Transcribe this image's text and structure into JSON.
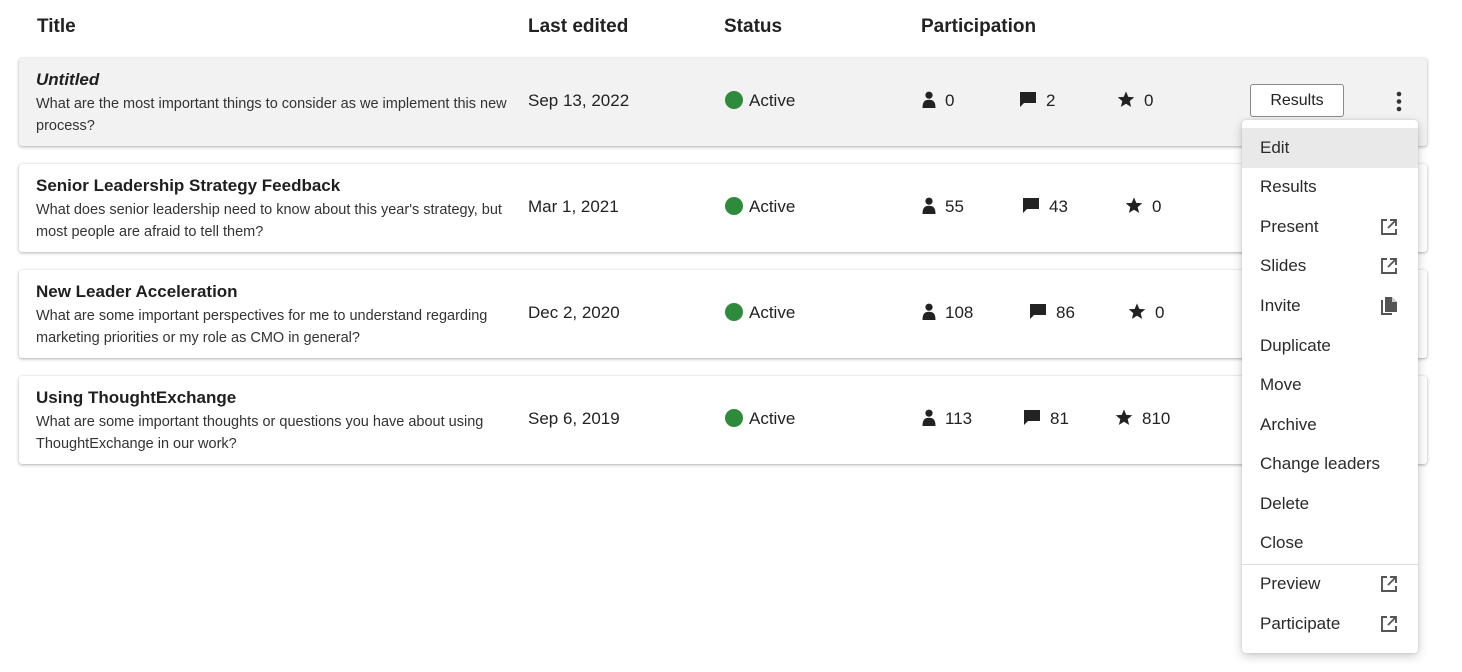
{
  "columns": {
    "title": "Title",
    "last_edited": "Last edited",
    "status": "Status",
    "participation": "Participation"
  },
  "exchanges": [
    {
      "title": "Untitled",
      "description": "What are the most important things to consider as we implement this new process?",
      "last_edited": "Sep 13, 2022",
      "status": "Active",
      "participants": "0",
      "thoughts": "2",
      "stars": "0"
    },
    {
      "title": "Senior Leadership Strategy Feedback",
      "description": "What does senior leadership need to know about this year's strategy, but most people are afraid to tell them?",
      "last_edited": "Mar 1, 2021",
      "status": "Active",
      "participants": "55",
      "thoughts": "43",
      "stars": "0"
    },
    {
      "title": "New Leader Acceleration",
      "description": "What are some important perspectives for me to understand regarding marketing priorities or my role as CMO in general?",
      "last_edited": "Dec 2, 2020",
      "status": "Active",
      "participants": "108",
      "thoughts": "86",
      "stars": "0"
    },
    {
      "title": "Using ThoughtExchange",
      "description": "What are some important thoughts or questions you have about using ThoughtExchange in our work?",
      "last_edited": "Sep 6, 2019",
      "status": "Active",
      "participants": "113",
      "thoughts": "81",
      "stars": "810"
    }
  ],
  "row_actions": {
    "results_button": "Results"
  },
  "context_menu": {
    "items": [
      {
        "label": "Edit",
        "icon": ""
      },
      {
        "label": "Results",
        "icon": ""
      },
      {
        "label": "Present",
        "icon": "open-in-new-icon"
      },
      {
        "label": "Slides",
        "icon": "open-in-new-icon"
      },
      {
        "label": "Invite",
        "icon": "copy-icon"
      },
      {
        "label": "Duplicate",
        "icon": ""
      },
      {
        "label": "Move",
        "icon": ""
      },
      {
        "label": "Archive",
        "icon": ""
      },
      {
        "label": "Change leaders",
        "icon": ""
      },
      {
        "label": "Delete",
        "icon": ""
      },
      {
        "label": "Close",
        "icon": ""
      },
      {
        "label": "Preview",
        "icon": "open-in-new-icon"
      },
      {
        "label": "Participate",
        "icon": "open-in-new-icon"
      }
    ]
  },
  "colors": {
    "status_active": "#2e8b3b",
    "highlight_row": "#f2f2f2",
    "menu_active": "#e9e9e9"
  }
}
